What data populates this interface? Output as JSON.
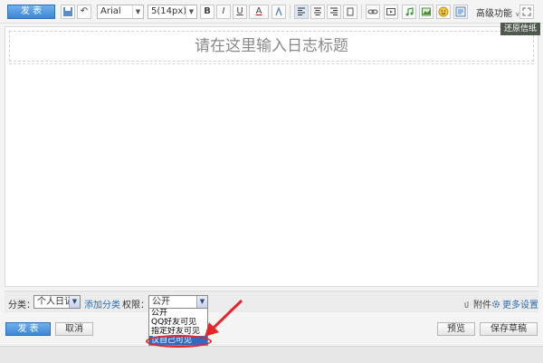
{
  "toolbar": {
    "publish_label": "发 表",
    "font_family": "Arial",
    "font_size": "5(14px)",
    "bold": "B",
    "italic": "I",
    "underline": "U",
    "font_color": "A",
    "advanced": "高级功能",
    "restore_tip": "还原信纸"
  },
  "editor": {
    "title_placeholder": "请在这里输入日志标题"
  },
  "options": {
    "category_label": "分类：",
    "category_value": "个人日记",
    "add_category": "添加分类",
    "permission_label": "权限：",
    "permission_value": "公开",
    "permission_options": [
      "公开",
      "QQ好友可见",
      "指定好友可见",
      "仅自己可见"
    ],
    "attachment": "附件",
    "more_settings": "更多设置"
  },
  "actions": {
    "publish": "发 表",
    "cancel": "取消",
    "preview": "预览",
    "save_draft": "保存草稿"
  },
  "colors": {
    "accent": "#3d86d3",
    "highlight": "#3169c6",
    "annotation": "#e2262b"
  }
}
